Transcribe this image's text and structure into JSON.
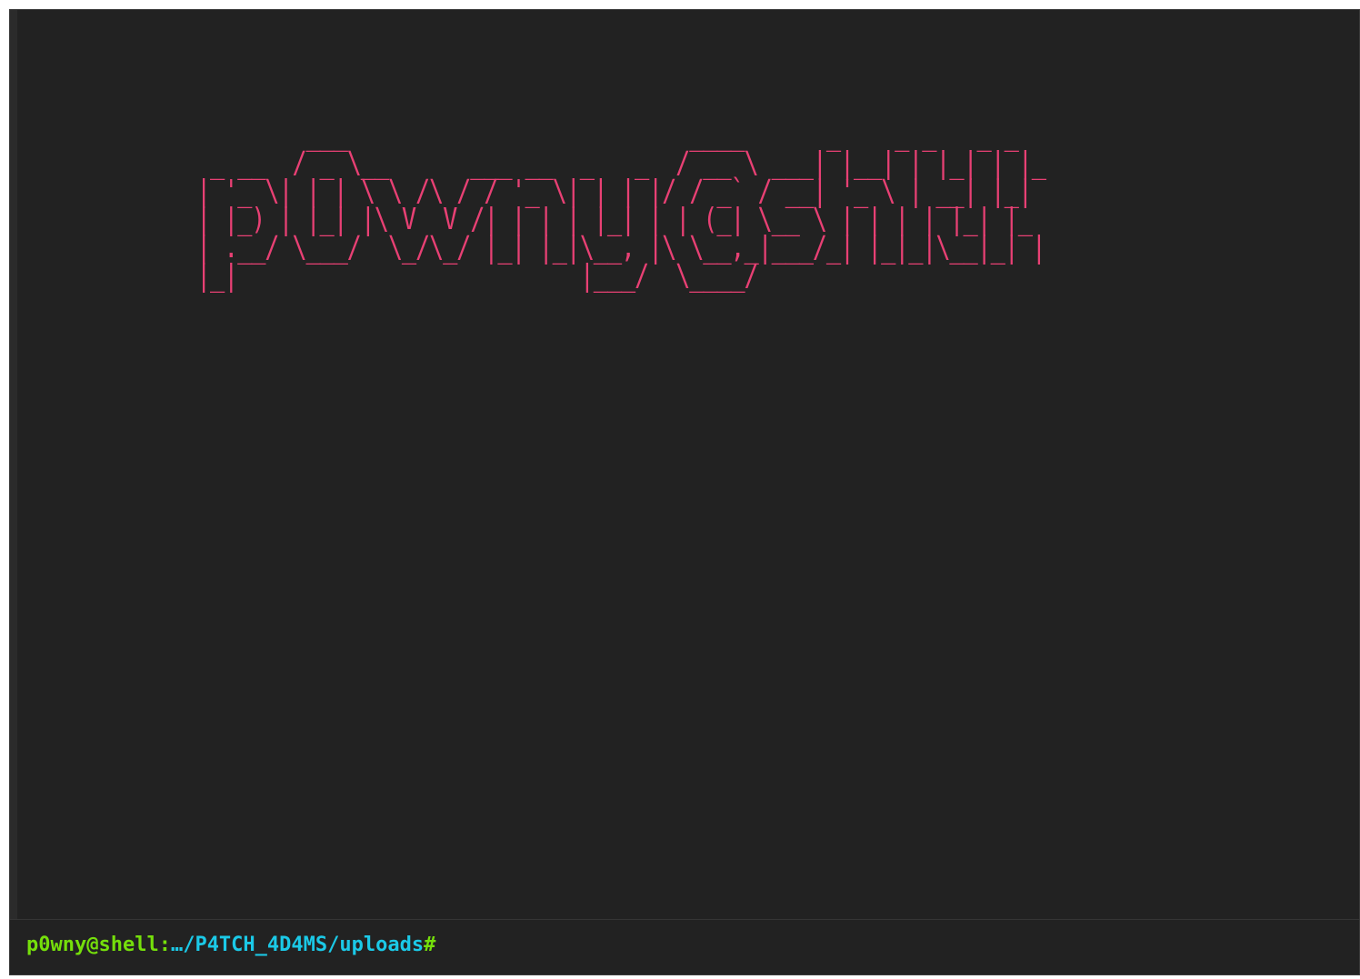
{
  "banner": {
    "ascii_art": "        ___                         ____      _    _ _   _ _\n _ __  / _ \\__      ___ __  _   _  / __ \\ ___| |__| | |_| | |_\n| '_ \\| | | \\ \\ /\\ / / '_ \\| | | |/ / _` / __| '_ \\ | __| |_|\n| |_) | |_| |\\ V  V /| | | | |_| | | (_| \\__ \\ | | | | |_| |_\n| .__/ \\___/  \\_/\\_/ |_| |_|\\__, |\\ \\__,_|___/_| |_|_|\\__|_| |\n|_|                         |___/  \\____/",
    "alt_text": "p0wny@shell:~#"
  },
  "prompt": {
    "user_host": "p0wny@shell:",
    "path": "…/P4TCH_4D4MS/uploads",
    "symbol": "#"
  },
  "input": {
    "value": "",
    "placeholder": ""
  },
  "colors": {
    "background": "#222222",
    "banner": "#e84074",
    "prompt_user": "#75df0b",
    "prompt_path": "#1bc9e7"
  }
}
